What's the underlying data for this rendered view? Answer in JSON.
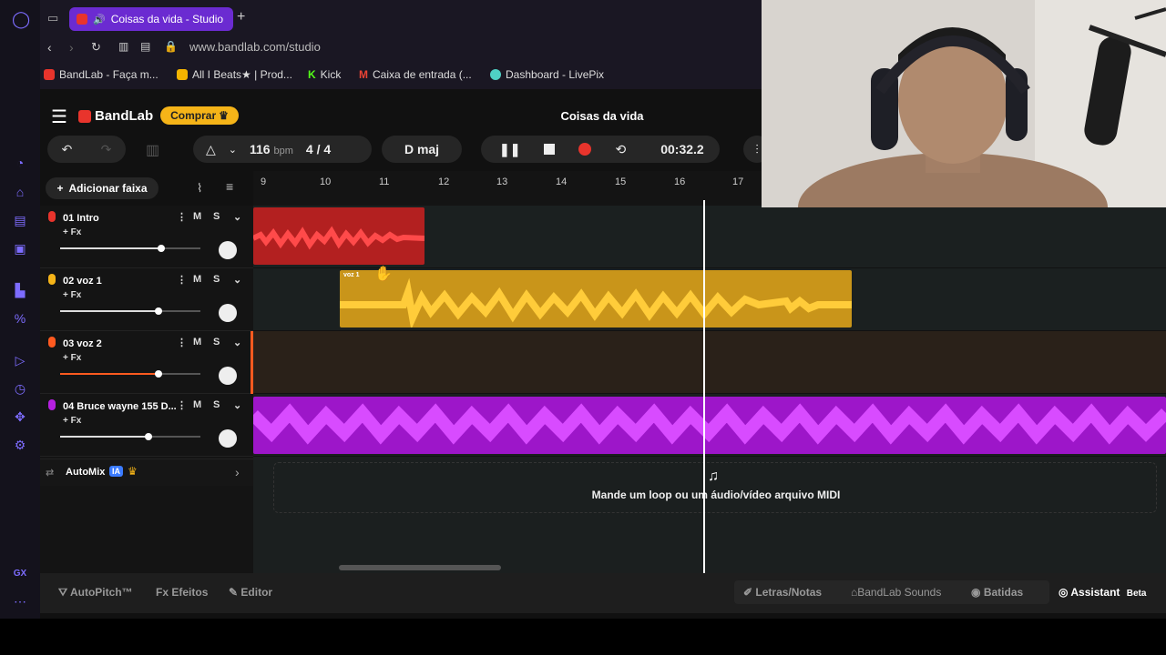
{
  "browser": {
    "tab_title": "Coisas da vida - Studio",
    "url": "www.bandlab.com/studio",
    "bookmarks": [
      {
        "label": "BandLab - Faça m...",
        "icon": "bandlab-icon",
        "color": "#e8342c"
      },
      {
        "label": "All I Beats★ | Prod...",
        "icon": "drive-icon",
        "color": "#f4b400"
      },
      {
        "label": "Kick",
        "icon": "kick-icon",
        "color": "#53fc18"
      },
      {
        "label": "Caixa de entrada (...",
        "icon": "gmail-icon",
        "color": "#ea4335"
      },
      {
        "label": "Dashboard - LivePix",
        "icon": "livepix-icon",
        "color": "#4fd1c5"
      }
    ]
  },
  "app": {
    "brand": "BandLab",
    "buy_label": "Comprar",
    "project_title": "Coisas da vida",
    "tempo": "116",
    "tempo_unit": "bpm",
    "time_sig": "4 / 4",
    "key": "D maj",
    "time": "00:32.2",
    "add_track_label": "Adicionar faixa",
    "automix_label": "AutoMix",
    "automix_badge": "IA",
    "drop_zone_text": "Mande um loop ou um áudio/vídeo arquivo MIDI",
    "ruler_ticks": [
      "9",
      "10",
      "11",
      "12",
      "13",
      "14",
      "15",
      "16",
      "17"
    ],
    "tracks": [
      {
        "name": "01  Intro",
        "fx": "+ Fx",
        "m": "M",
        "s": "S",
        "color": "#e8342c",
        "volume": 0.72
      },
      {
        "name": "02  voz 1",
        "fx": "+ Fx",
        "m": "M",
        "s": "S",
        "color": "#f5b418",
        "volume": 0.7,
        "clip_label": "voz 1"
      },
      {
        "name": "03  voz 2",
        "fx": "+ Fx",
        "m": "M",
        "s": "S",
        "color": "#ff5a1f",
        "volume": 0.7
      },
      {
        "name": "04  Bruce wayne 155 D...",
        "fx": "+ Fx",
        "m": "M",
        "s": "S",
        "color": "#b620e0",
        "volume": 0.63
      }
    ],
    "bottom": {
      "autopitch": "AutoPitch™",
      "efeitos": "Efeitos",
      "editor": "Editor",
      "letras": "Letras/Notas",
      "sounds": "BandLab Sounds",
      "batidas": "Batidas",
      "assistant": "Assistant",
      "beta": "Beta"
    }
  },
  "colors": {
    "accent": "#6b2bd1",
    "record": "#e8342c",
    "buy": "#f5b418"
  }
}
